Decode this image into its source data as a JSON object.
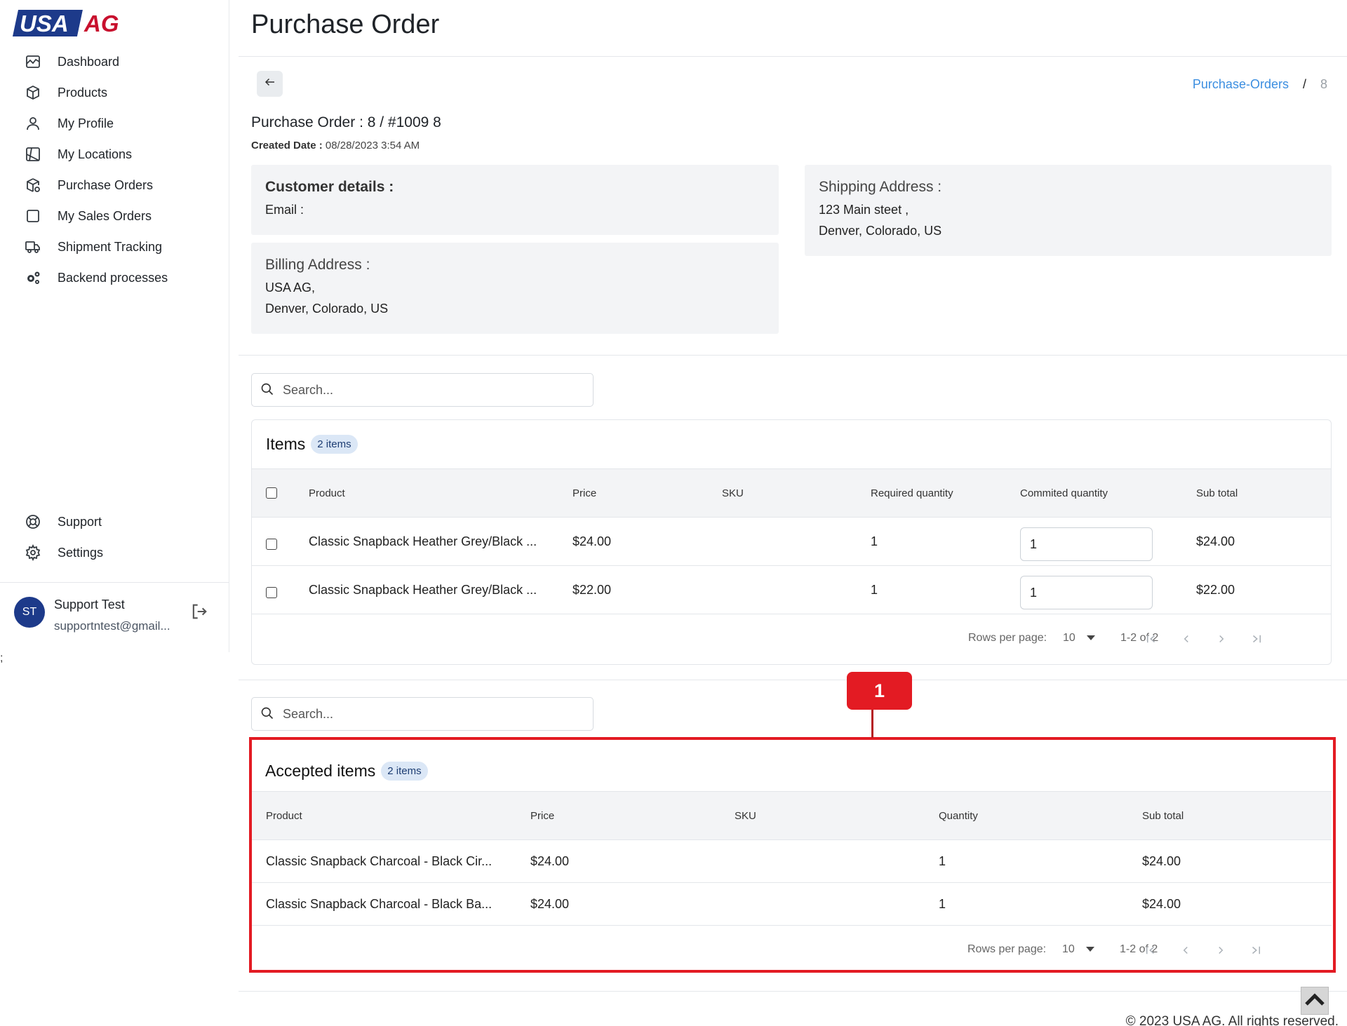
{
  "brand": {
    "part1": "USA",
    "part2": "AG",
    "primary": "#1d3a8a",
    "accent": "#c8102e"
  },
  "sidebar": {
    "items": [
      {
        "label": "Dashboard",
        "icon": "chart-line-icon"
      },
      {
        "label": "Products",
        "icon": "box-icon"
      },
      {
        "label": "My Profile",
        "icon": "user-icon"
      },
      {
        "label": "My Locations",
        "icon": "map-icon"
      },
      {
        "label": "Purchase Orders",
        "icon": "package-cog-icon"
      },
      {
        "label": "My Sales Orders",
        "icon": "square-icon"
      },
      {
        "label": "Shipment Tracking",
        "icon": "truck-icon"
      },
      {
        "label": "Backend processes",
        "icon": "gears-icon"
      }
    ],
    "bottom_items": [
      {
        "label": "Support",
        "icon": "lifebuoy-icon"
      },
      {
        "label": "Settings",
        "icon": "gear-icon"
      }
    ],
    "user": {
      "initials": "ST",
      "name": "Support Test",
      "email": "supportntest@gmail..."
    },
    "stray_text": ";"
  },
  "page": {
    "title": "Purchase Order",
    "breadcrumb": {
      "link": "Purchase-Orders",
      "separator": "/",
      "current": "8"
    },
    "order_title": "Purchase Order : 8 / #1009 8",
    "created_label": "Created Date :",
    "created_value": "08/28/2023 3:54 AM"
  },
  "customer": {
    "heading": "Customer details :",
    "email_label": "Email :"
  },
  "billing": {
    "heading": "Billing Address :",
    "line1": "USA AG,",
    "line2": "Denver, Colorado, US"
  },
  "shipping": {
    "heading": "Shipping Address :",
    "line1": "123 Main steet ,",
    "line2": "Denver, Colorado, US"
  },
  "items_table": {
    "search_placeholder": "Search...",
    "title": "Items",
    "badge": "2 items",
    "columns": [
      "Product",
      "Price",
      "SKU",
      "Required quantity",
      "Commited quantity",
      "Sub total"
    ],
    "rows": [
      {
        "product": "Classic Snapback Heather Grey/Black ...",
        "price": "$24.00",
        "sku": "",
        "required": "1",
        "committed": "1",
        "subtotal": "$24.00"
      },
      {
        "product": "Classic Snapback Heather Grey/Black ...",
        "price": "$22.00",
        "sku": "",
        "required": "1",
        "committed": "1",
        "subtotal": "$22.00"
      }
    ],
    "pager": {
      "rows_label": "Rows per page:",
      "rows_value": "10",
      "range": "1-2 of 2"
    }
  },
  "accepted_table": {
    "search_placeholder": "Search...",
    "title": "Accepted items",
    "badge": "2 items",
    "columns": [
      "Product",
      "Price",
      "SKU",
      "Quantity",
      "Sub total"
    ],
    "rows": [
      {
        "product": "Classic Snapback Charcoal - Black Cir...",
        "price": "$24.00",
        "sku": "",
        "quantity": "1",
        "subtotal": "$24.00"
      },
      {
        "product": "Classic Snapback Charcoal - Black Ba...",
        "price": "$24.00",
        "sku": "",
        "quantity": "1",
        "subtotal": "$24.00"
      }
    ],
    "pager": {
      "rows_label": "Rows per page:",
      "rows_value": "10",
      "range": "1-2 of 2"
    }
  },
  "annotation": {
    "label": "1",
    "color": "#e31b23"
  },
  "footer": {
    "text": "© 2023 USA AG. All rights reserved."
  }
}
